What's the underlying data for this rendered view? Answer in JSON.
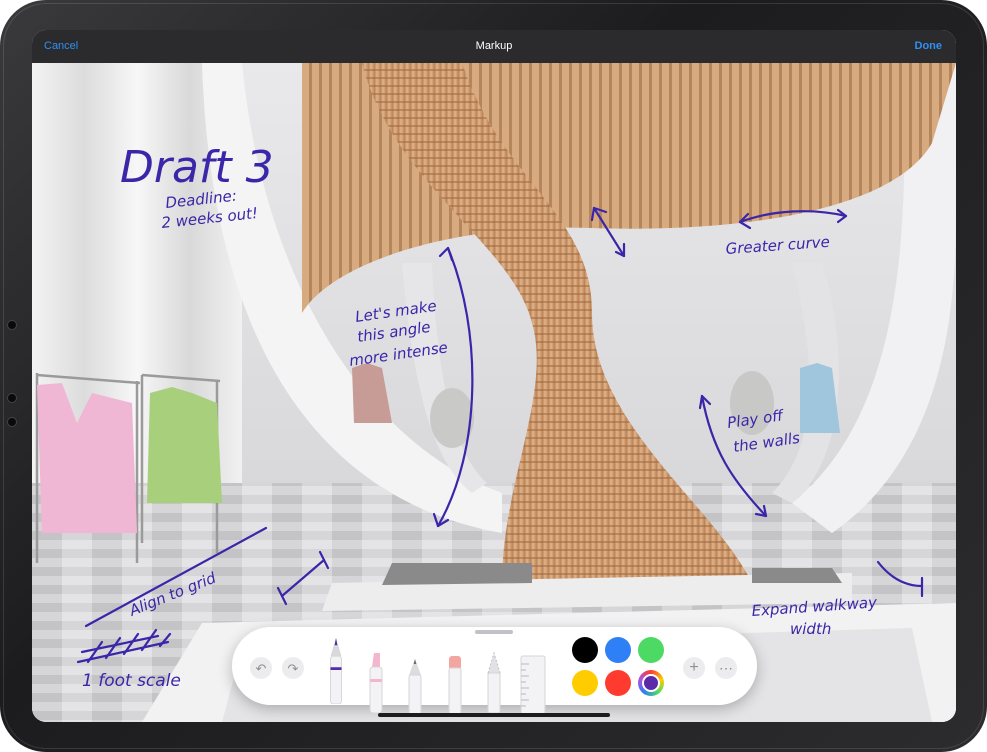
{
  "navbar": {
    "cancel_label": "Cancel",
    "title": "Markup",
    "done_label": "Done"
  },
  "annotations": {
    "draft": "Draft 3",
    "deadline_line1": "Deadline:",
    "deadline_line2": "2 weeks out!",
    "angle_line1": "Let's make",
    "angle_line2": "this angle",
    "angle_line3": "more intense",
    "curve": "Greater curve",
    "walls_line1": "Play off",
    "walls_line2": "the walls",
    "grid": "Align to grid",
    "scale": "1 foot scale",
    "walkway_line1": "Expand walkway",
    "walkway_line2": "width"
  },
  "toolbar": {
    "undo_icon": "undo-arrow-icon",
    "redo_icon": "redo-arrow-icon",
    "tools": [
      "pen-tool",
      "marker-tool",
      "pencil-tool",
      "eraser-tool",
      "lasso-tool",
      "ruler-tool"
    ],
    "add_label": "+",
    "more_label": "⋯",
    "colors": [
      "#000000",
      "#2f7ff7",
      "#4cd964",
      "#ffcc00",
      "#ff3b30",
      "#5b2aa8"
    ]
  }
}
